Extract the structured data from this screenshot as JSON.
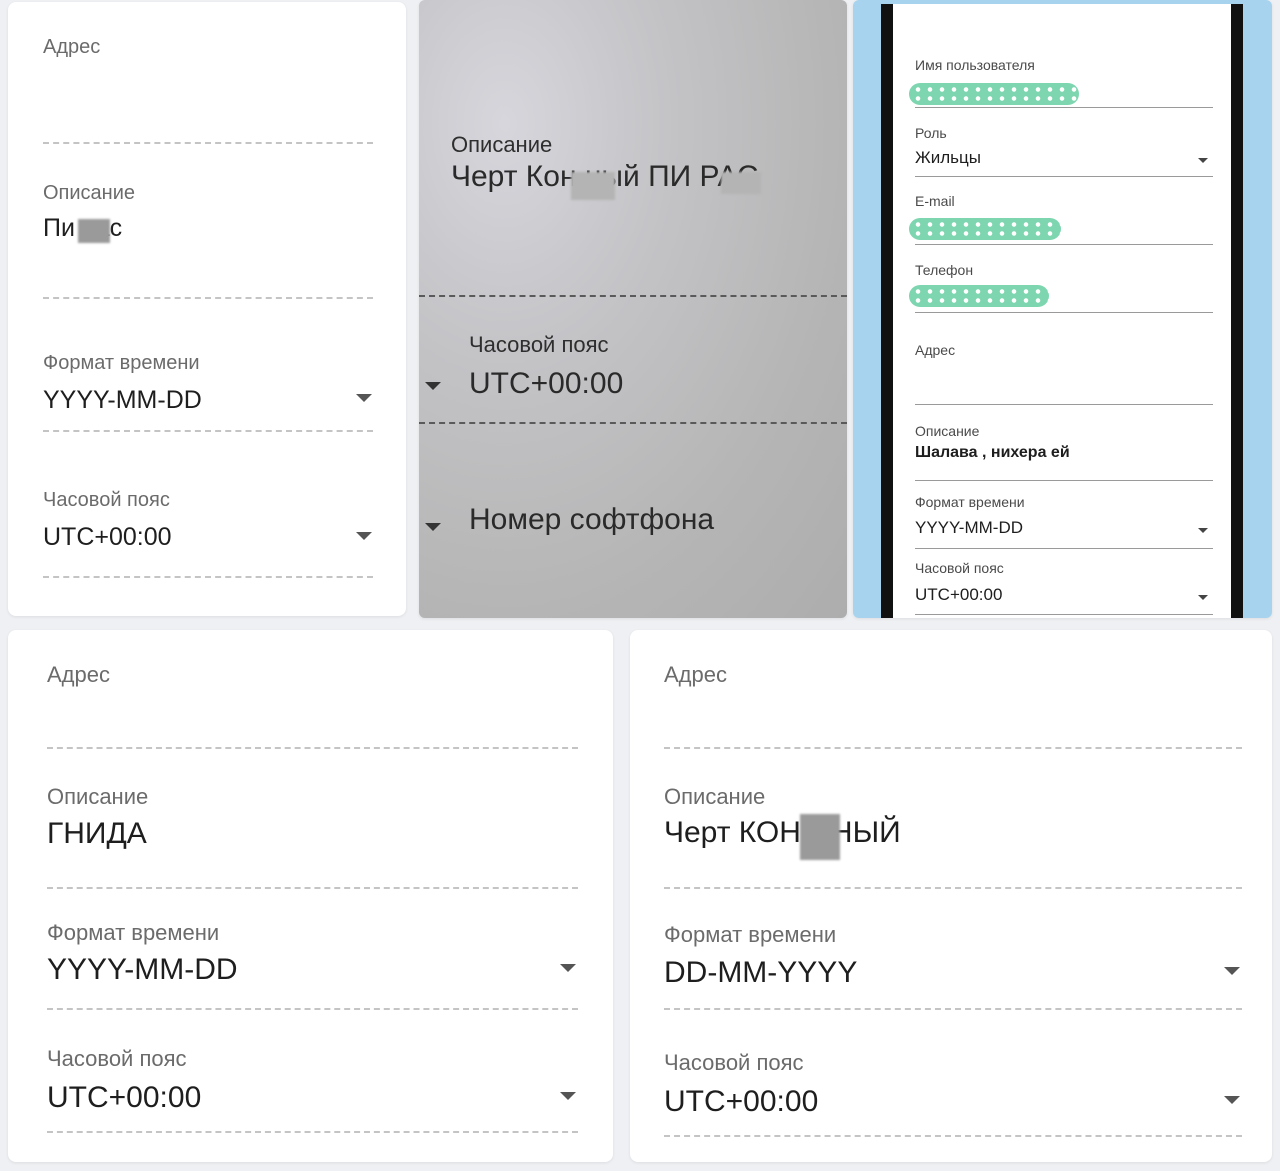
{
  "panel1": {
    "address_label": "Адрес",
    "description_label": "Описание",
    "description_value": "Пи  рас",
    "time_format_label": "Формат времени",
    "time_format_value": "YYYY-MM-DD",
    "timezone_label": "Часовой пояс",
    "timezone_value": "UTC+00:00"
  },
  "panel2": {
    "description_label": "Описание",
    "description_value": "Черт Кон    ный ПИ    РАС",
    "timezone_label": "Часовой пояс",
    "timezone_value": "UTC+00:00",
    "softphone_label": "Номер софтфона"
  },
  "panel3": {
    "username_label": "Имя пользователя",
    "role_label": "Роль",
    "role_value": "Жильцы",
    "email_label": "E-mail",
    "phone_label": "Телефон",
    "address_label": "Адрес",
    "description_label": "Описание",
    "description_value": "Шалава , нихера ей",
    "time_format_label": "Формат времени",
    "time_format_value": "YYYY-MM-DD",
    "timezone_label": "Часовой пояс",
    "timezone_value": "UTC+00:00"
  },
  "panel4": {
    "address_label": "Адрес",
    "description_label": "Описание",
    "description_value": "ГНИДА",
    "time_format_label": "Формат времени",
    "time_format_value": "YYYY-MM-DD",
    "timezone_label": "Часовой пояс",
    "timezone_value": "UTC+00:00"
  },
  "panel5": {
    "address_label": "Адрес",
    "description_label": "Описание",
    "description_value": "Черт КОН    ННЫЙ",
    "time_format_label": "Формат времени",
    "time_format_value": "DD-MM-YYYY",
    "timezone_label": "Часовой пояс",
    "timezone_value": "UTC+00:00"
  },
  "colors": {
    "page_bg": "#eef0f3",
    "card_bg": "#ffffff",
    "label": "#6b6b6b",
    "phone_frame": "#a8d3ee",
    "masked_pill": "#7ed6b0"
  }
}
